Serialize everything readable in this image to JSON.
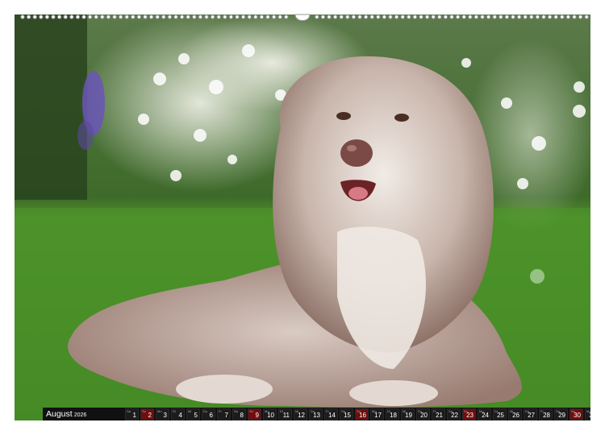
{
  "calendar": {
    "month": "August",
    "year": "2026",
    "days": [
      {
        "wd": "Sa",
        "d": "1"
      },
      {
        "wd": "So",
        "d": "2"
      },
      {
        "wd": "Mo",
        "d": "3"
      },
      {
        "wd": "Di",
        "d": "4"
      },
      {
        "wd": "Mi",
        "d": "5"
      },
      {
        "wd": "Do",
        "d": "6"
      },
      {
        "wd": "Fr",
        "d": "7"
      },
      {
        "wd": "Sa",
        "d": "8"
      },
      {
        "wd": "So",
        "d": "9"
      },
      {
        "wd": "Mo",
        "d": "10"
      },
      {
        "wd": "Di",
        "d": "11"
      },
      {
        "wd": "Mi",
        "d": "12"
      },
      {
        "wd": "Do",
        "d": "13"
      },
      {
        "wd": "Fr",
        "d": "14"
      },
      {
        "wd": "Sa",
        "d": "15"
      },
      {
        "wd": "So",
        "d": "16"
      },
      {
        "wd": "Mo",
        "d": "17"
      },
      {
        "wd": "Di",
        "d": "18"
      },
      {
        "wd": "Mi",
        "d": "19"
      },
      {
        "wd": "Do",
        "d": "20"
      },
      {
        "wd": "Fr",
        "d": "21"
      },
      {
        "wd": "Sa",
        "d": "22"
      },
      {
        "wd": "So",
        "d": "23"
      },
      {
        "wd": "Mo",
        "d": "24"
      },
      {
        "wd": "Di",
        "d": "25"
      },
      {
        "wd": "Mi",
        "d": "26"
      },
      {
        "wd": "Do",
        "d": "27"
      },
      {
        "wd": "Fr",
        "d": "28"
      },
      {
        "wd": "Sa",
        "d": "29"
      },
      {
        "wd": "So",
        "d": "30"
      },
      {
        "wd": "Mo",
        "d": "31"
      }
    ],
    "sunday_color": "#6e0e0e"
  },
  "photo": {
    "subject": "bearded-collie-dog",
    "grass_color": "#4f9a2c",
    "foliage_color": "#3d6e2a",
    "flower_color": "#f4f6ee",
    "fur_color": "#b59c93"
  }
}
